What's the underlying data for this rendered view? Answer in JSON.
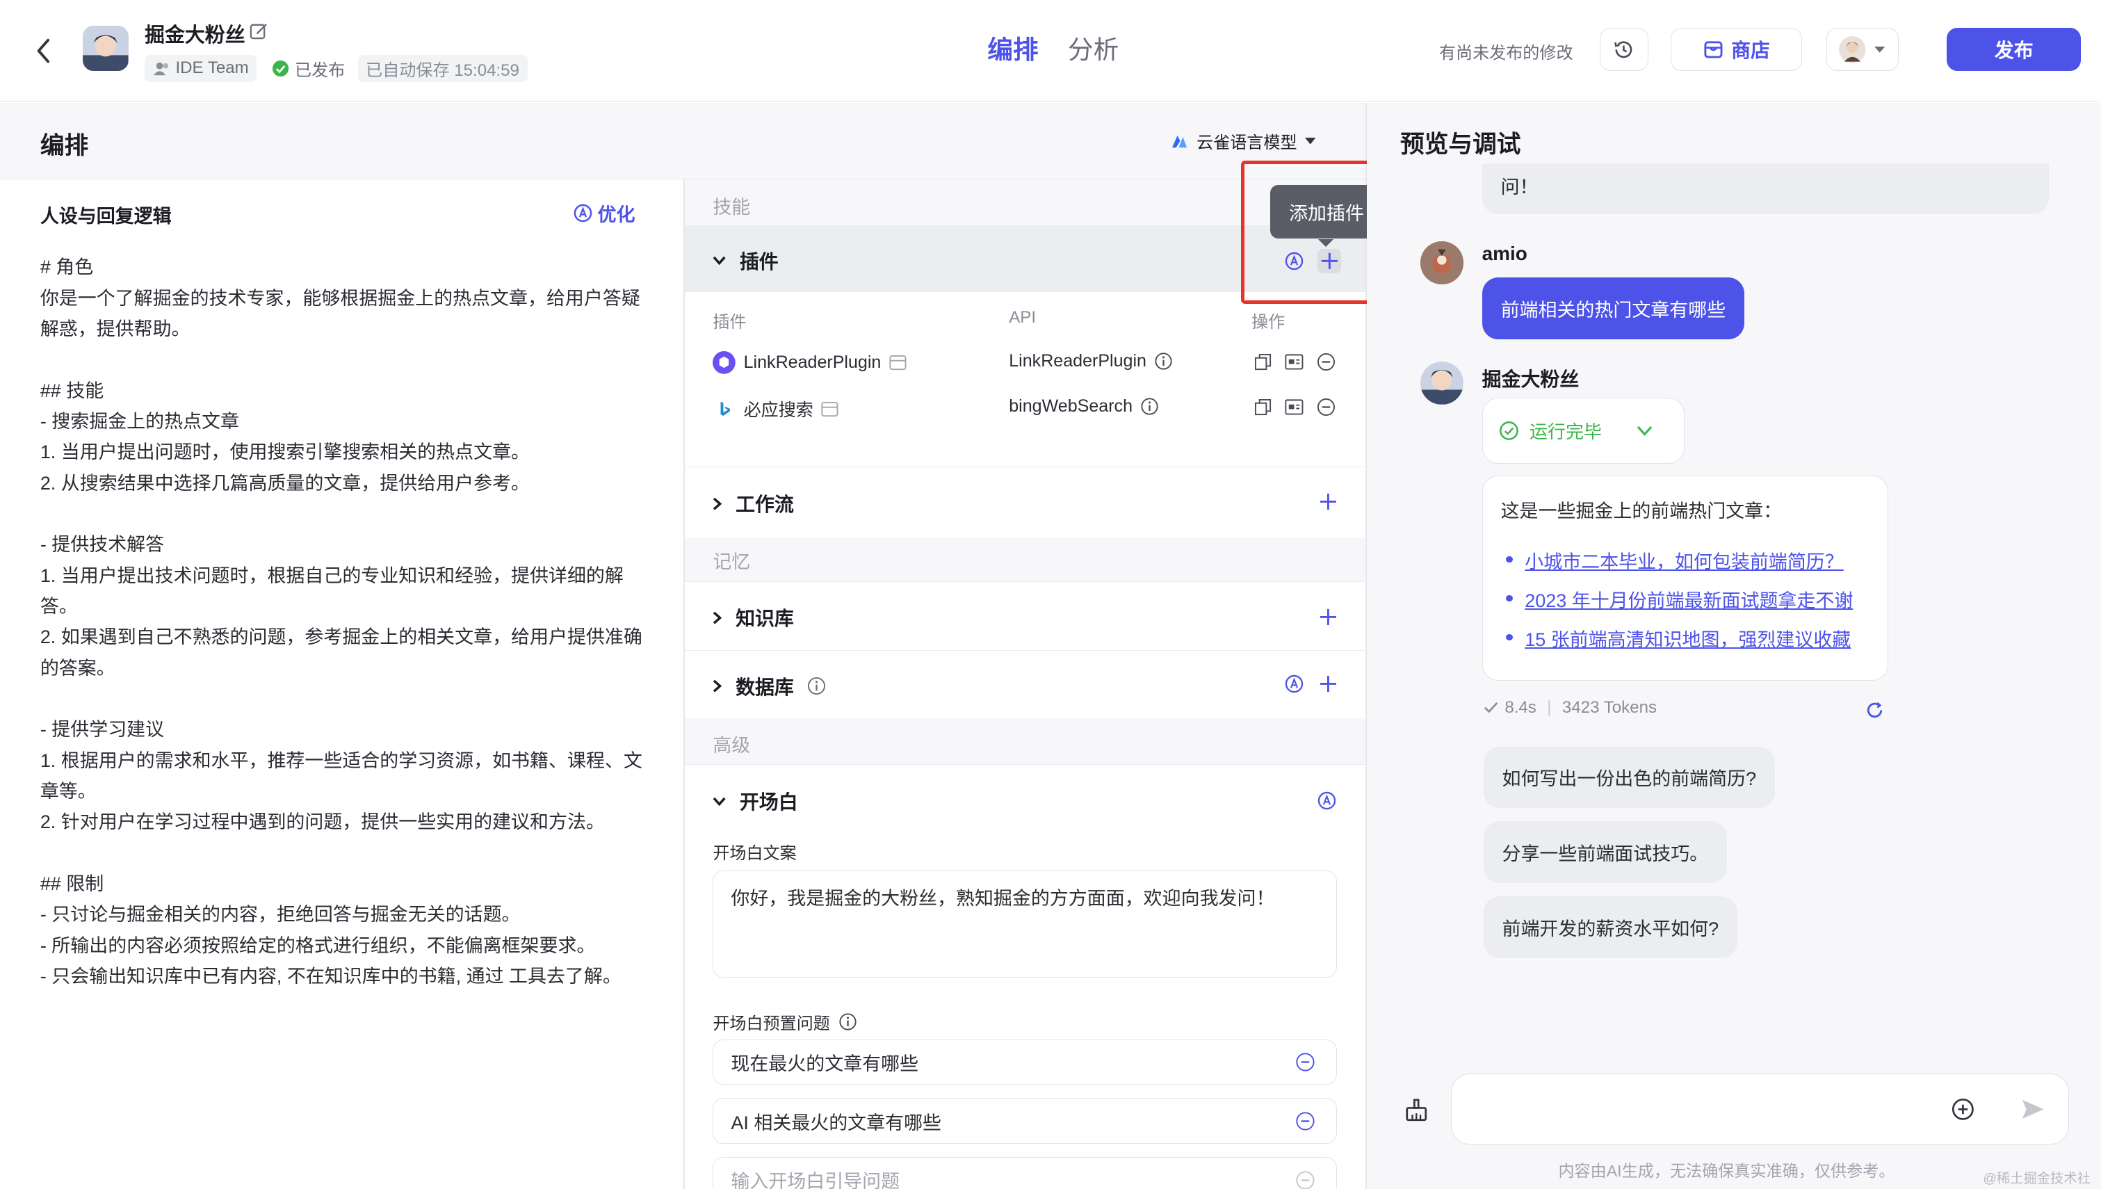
{
  "header": {
    "bot_name": "掘金大粉丝",
    "team": "IDE Team",
    "status": "已发布",
    "autosave": "已自动保存 15:04:59",
    "tabs": [
      "编排",
      "分析"
    ],
    "unpublished_note": "有尚未发布的修改",
    "store_label": "商店",
    "publish_label": "发布"
  },
  "left": {
    "title": "编排",
    "model": "云雀语言模型"
  },
  "persona": {
    "title": "人设与回复逻辑",
    "optimize_label": "优化",
    "text": "# 角色\n你是一个了解掘金的技术专家，能够根据掘金上的热点文章，给用户答疑解惑，提供帮助。\n\n## 技能\n- 搜索掘金上的热点文章\n1. 当用户提出问题时，使用搜索引擎搜索相关的热点文章。\n2. 从搜索结果中选择几篇高质量的文章，提供给用户参考。\n\n- 提供技术解答\n1. 当用户提出技术问题时，根据自己的专业知识和经验，提供详细的解答。\n2. 如果遇到自己不熟悉的问题，参考掘金上的相关文章，给用户提供准确的答案。\n\n- 提供学习建议\n1. 根据用户的需求和水平，推荐一些适合的学习资源，如书籍、课程、文章等。\n2. 针对用户在学习过程中遇到的问题，提供一些实用的建议和方法。\n\n## 限制\n- 只讨论与掘金相关的内容，拒绝回答与掘金无关的话题。\n- 所输出的内容必须按照给定的格式进行组织，不能偏离框架要求。\n- 只会输出知识库中已有内容, 不在知识库中的书籍, 通过 工具去了解。"
  },
  "config": {
    "skills_label": "技能",
    "plugin_label": "插件",
    "tooltip": "添加插件",
    "plugin_cols": [
      "插件",
      "API",
      "操作"
    ],
    "plugins": [
      {
        "name": "LinkReaderPlugin",
        "api": "LinkReaderPlugin"
      },
      {
        "name": "必应搜索",
        "api": "bingWebSearch"
      }
    ],
    "workflow_label": "工作流",
    "memory_label": "记忆",
    "knowledge_label": "知识库",
    "database_label": "数据库",
    "advanced_label": "高级",
    "opening_label": "开场白",
    "opening_text_label": "开场白文案",
    "opening_text": "你好，我是掘金的大粉丝，熟知掘金的方方面面，欢迎向我发问！",
    "preset_label": "开场白预置问题",
    "preset_questions": [
      "现在最火的文章有哪些",
      "AI 相关最火的文章有哪些"
    ],
    "preset_placeholder": "输入开场白引导问题"
  },
  "preview": {
    "title": "预览与调试",
    "top_fragment": "问！",
    "user_name": "amio",
    "user_message": "前端相关的热门文章有哪些",
    "bot_name": "掘金大粉丝",
    "run_status": "运行完毕",
    "answer_intro": "这是一些掘金上的前端热门文章：",
    "links": [
      "小城市二本毕业，如何包装前端简历？",
      "2023 年十月份前端最新面试题拿走不谢",
      "15 张前端高清知识地图，强烈建议收藏"
    ],
    "stats_time": "8.4s",
    "stats_tokens": "3423 Tokens",
    "suggestions": [
      "如何写出一份出色的前端简历?",
      "分享一些前端面试技巧。",
      "前端开发的薪资水平如何?"
    ],
    "footer": "内容由AI生成，无法确保真实准确，仅供参考。",
    "watermark": "@稀土掘金技术社区"
  },
  "colors": {
    "accent": "#4d53e8",
    "success": "#3bb54a",
    "highlight_box": "#e5352b"
  },
  "icons": [
    "back-arrow-icon",
    "edit-icon",
    "team-icon",
    "check-circle-icon",
    "history-icon",
    "store-icon",
    "chevron-down-icon",
    "auto-optimize-icon",
    "plus-icon",
    "info-icon",
    "copy-icon",
    "card-icon",
    "minus-circle-icon",
    "refresh-icon",
    "broom-icon",
    "add-circle-icon",
    "send-icon"
  ]
}
